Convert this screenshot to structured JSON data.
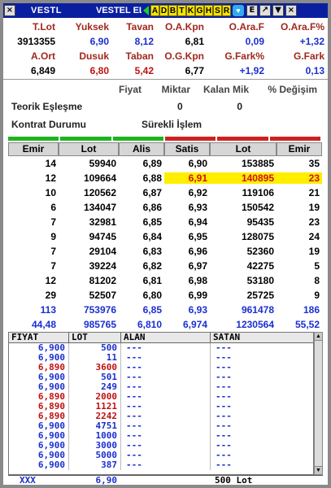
{
  "titlebar": {
    "close": "×",
    "symbol": "VESTL",
    "name": "VESTEL ELEKTRONIK",
    "letters": [
      "A",
      "D",
      "B",
      "T",
      "K",
      "G",
      "H",
      "S",
      "R"
    ],
    "buttons": [
      "E",
      "↗",
      "▼",
      "×"
    ]
  },
  "stats": {
    "row1_labels": [
      "T.Lot",
      "Yuksek",
      "Tavan",
      "O.A.Kpn",
      "O.Ara.F",
      "O.Ara.F%"
    ],
    "row1_values": [
      "3913355",
      "6,90",
      "8,12",
      "6,81",
      "0,09",
      "+1,32"
    ],
    "row2_labels": [
      "A.Ort",
      "Dusuk",
      "Taban",
      "O.G.Kpn",
      "G.Fark%",
      "G.Fark"
    ],
    "row2_values": [
      "6,849",
      "6,80",
      "5,42",
      "6,77",
      "+1,92",
      "0,13"
    ]
  },
  "info": {
    "headers": [
      "Fiyat",
      "Miktar",
      "Kalan Mik",
      "% Değişim"
    ],
    "teorik_label": "Teorik Eşleşme",
    "teorik_miktar": "0",
    "teorik_kalan": "0",
    "kontrat_label": "Kontrat Durumu",
    "kontrat_value": "Sürekli İşlem"
  },
  "depth": {
    "headers": [
      "Emir",
      "Lot",
      "Alis",
      "Satis",
      "Lot",
      "Emir"
    ],
    "rows": [
      [
        "14",
        "59940",
        "6,89",
        "6,90",
        "153885",
        "35"
      ],
      [
        "12",
        "109664",
        "6,88",
        "6,91",
        "140895",
        "23"
      ],
      [
        "10",
        "120562",
        "6,87",
        "6,92",
        "119106",
        "21"
      ],
      [
        "6",
        "134047",
        "6,86",
        "6,93",
        "150542",
        "19"
      ],
      [
        "7",
        "32981",
        "6,85",
        "6,94",
        "95435",
        "23"
      ],
      [
        "9",
        "94745",
        "6,84",
        "6,95",
        "128075",
        "24"
      ],
      [
        "7",
        "29104",
        "6,83",
        "6,96",
        "52360",
        "19"
      ],
      [
        "7",
        "39224",
        "6,82",
        "6,97",
        "42275",
        "5"
      ],
      [
        "12",
        "81202",
        "6,81",
        "6,98",
        "53180",
        "8"
      ],
      [
        "29",
        "52507",
        "6,80",
        "6,99",
        "25725",
        "9"
      ]
    ],
    "total": [
      "113",
      "753976",
      "6,85",
      "6,93",
      "961478",
      "186"
    ],
    "avg": [
      "44,48",
      "985765",
      "6,810",
      "6,974",
      "1230564",
      "55,52"
    ]
  },
  "trades": {
    "headers": [
      "FIYAT",
      "LOT",
      "ALAN",
      "SATAN"
    ],
    "rows": [
      {
        "price": "6,900",
        "lot": "500",
        "alan": "---",
        "satan": "---",
        "dir": "up"
      },
      {
        "price": "6,900",
        "lot": "11",
        "alan": "---",
        "satan": "---",
        "dir": "up"
      },
      {
        "price": "6,890",
        "lot": "3600",
        "alan": "---",
        "satan": "---",
        "dir": "down"
      },
      {
        "price": "6,900",
        "lot": "501",
        "alan": "---",
        "satan": "---",
        "dir": "up"
      },
      {
        "price": "6,900",
        "lot": "249",
        "alan": "---",
        "satan": "---",
        "dir": "up"
      },
      {
        "price": "6,890",
        "lot": "2000",
        "alan": "---",
        "satan": "---",
        "dir": "down"
      },
      {
        "price": "6,890",
        "lot": "1121",
        "alan": "---",
        "satan": "---",
        "dir": "down"
      },
      {
        "price": "6,890",
        "lot": "2242",
        "alan": "---",
        "satan": "---",
        "dir": "down"
      },
      {
        "price": "6,900",
        "lot": "4751",
        "alan": "---",
        "satan": "---",
        "dir": "up"
      },
      {
        "price": "6,900",
        "lot": "1000",
        "alan": "---",
        "satan": "---",
        "dir": "up"
      },
      {
        "price": "6,900",
        "lot": "3000",
        "alan": "---",
        "satan": "---",
        "dir": "up"
      },
      {
        "price": "6,900",
        "lot": "5000",
        "alan": "---",
        "satan": "---",
        "dir": "up"
      },
      {
        "price": "6,900",
        "lot": "387",
        "alan": "---",
        "satan": "---",
        "dir": "up"
      }
    ]
  },
  "summary": {
    "label": "XXX",
    "price": "6,90",
    "satan": "500 Lot"
  },
  "colors": {
    "title_bg": "#0a1fa0",
    "label_red": "#a0281e",
    "value_blue": "#1a2fd0",
    "value_red": "#c01010",
    "highlight": "#ffee00"
  }
}
